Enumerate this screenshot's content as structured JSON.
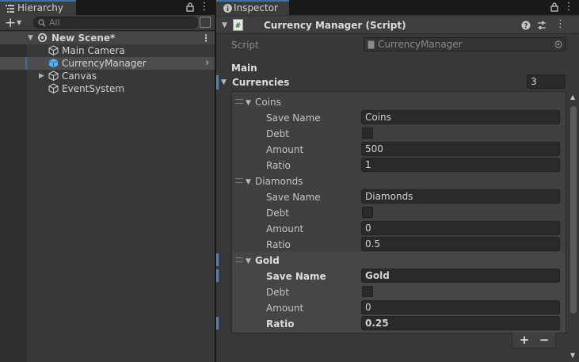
{
  "hierarchy": {
    "tab_label": "Hierarchy",
    "search_placeholder": "All",
    "add_label": "+",
    "scene": {
      "name": "New Scene*"
    },
    "items": [
      {
        "label": "Main Camera"
      },
      {
        "label": "CurrencyManager"
      },
      {
        "label": "Canvas"
      },
      {
        "label": "EventSystem"
      }
    ]
  },
  "inspector": {
    "tab_label": "Inspector",
    "component_title": "Currency Manager (Script)",
    "script_label": "Script",
    "script_value": "CurrencyManager",
    "section_header": "Main",
    "list_label": "Currencies",
    "list_size": "3",
    "field_labels": {
      "save_name": "Save Name",
      "debt": "Debt",
      "amount": "Amount",
      "ratio": "Ratio"
    },
    "currencies": [
      {
        "name": "Coins",
        "save_name": "Coins",
        "amount": "500",
        "ratio": "1"
      },
      {
        "name": "Diamonds",
        "save_name": "Diamonds",
        "amount": "0",
        "ratio": "0.5"
      },
      {
        "name": "Gold",
        "save_name": "Gold",
        "amount": "0",
        "ratio": "0.25"
      }
    ],
    "add_label": "+",
    "remove_label": "−"
  },
  "icons": {
    "hierarchy_tab": "list-icon",
    "inspector_tab": "info-icon",
    "lock": "lock-icon",
    "menu": "kebab-menu-icon",
    "script": "csharp-script-icon",
    "help": "help-icon",
    "presets": "presets-icon",
    "unity_scene": "unity-logo-icon",
    "gameobject": "cube-icon",
    "search": "search-icon",
    "scene_visibility": "scene-visibility-icon",
    "object_picker": "object-picker-icon"
  },
  "colors": {
    "accent_blue": "#3a72b0",
    "selection_cube": "#5ab4e8",
    "panel_bg": "#383838",
    "field_bg": "#2a2a2a"
  }
}
